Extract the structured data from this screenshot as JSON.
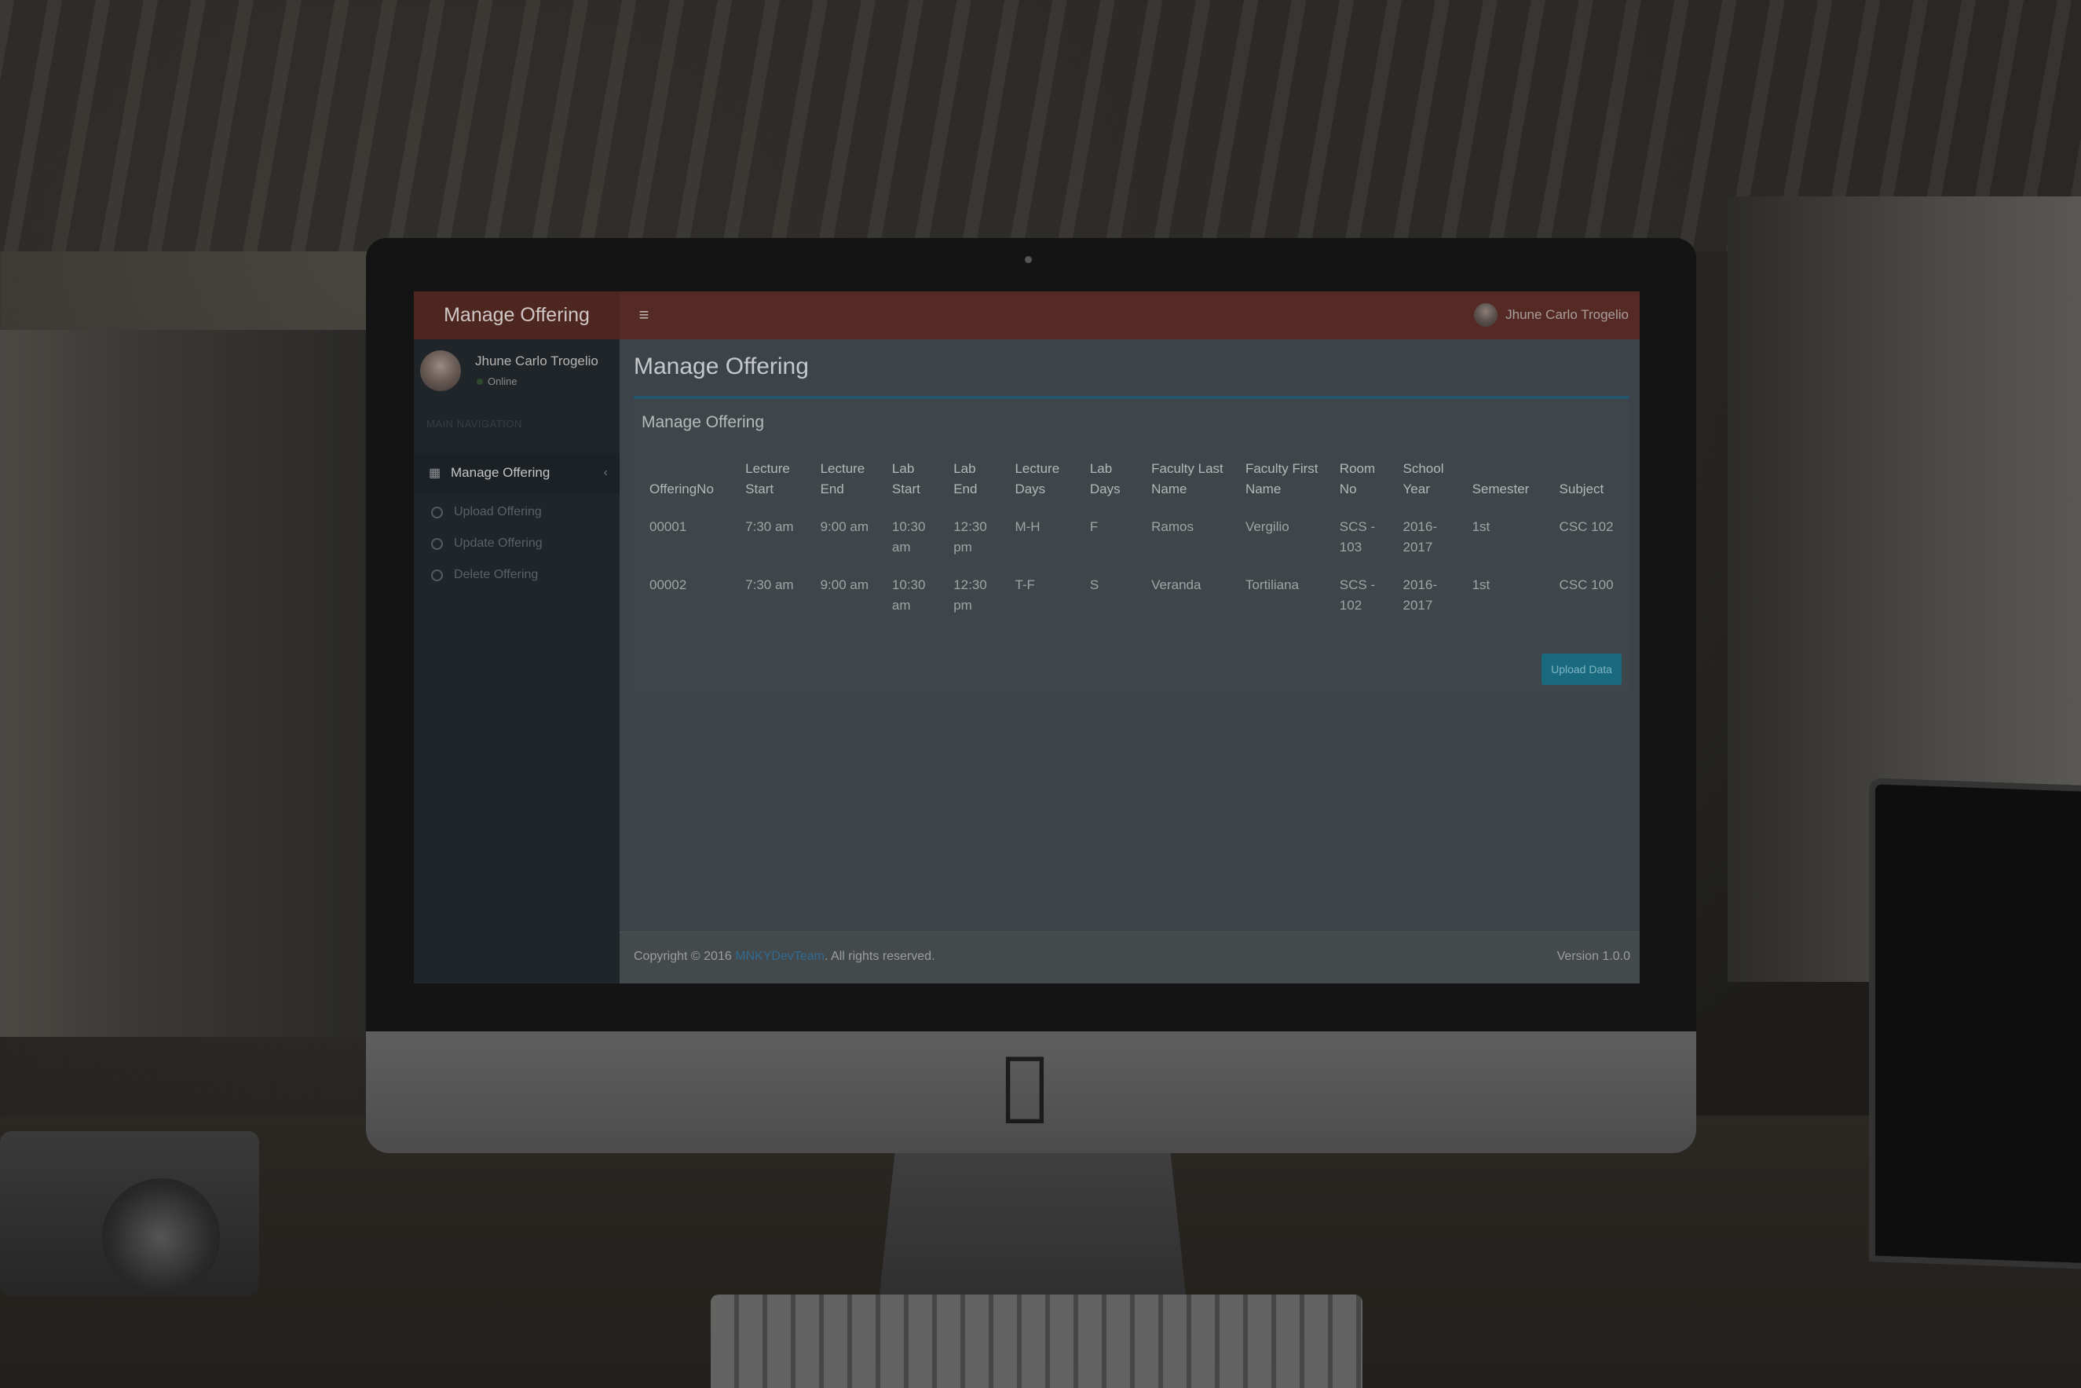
{
  "app": {
    "brand": "Manage Offering",
    "menu_icon": "hamburger-icon",
    "user_name": "Jhune Carlo Trogelio"
  },
  "sidebar": {
    "user_name": "Jhune Carlo Trogelio",
    "status": "Online",
    "nav_header": "MAIN NAVIGATION",
    "main_item": {
      "label": "Manage Offering",
      "icon": "table-icon",
      "chevron": "chevron-left-icon"
    },
    "sub_items": [
      {
        "label": "Upload Offering"
      },
      {
        "label": "Update Offering"
      },
      {
        "label": "Delete Offering"
      }
    ]
  },
  "main": {
    "page_title": "Manage Offering",
    "box_title": "Manage Offering",
    "table": {
      "headers": [
        "OfferingNo",
        "Lecture Start",
        "Lecture End",
        "Lab Start",
        "Lab End",
        "Lecture Days",
        "Lab Days",
        "Faculty Last Name",
        "Faculty First Name",
        "Room No",
        "School Year",
        "Semester",
        "Subject"
      ],
      "rows": [
        [
          "00001",
          "7:30 am",
          "9:00 am",
          "10:30 am",
          "12:30 pm",
          "M-H",
          "F",
          "Ramos",
          "Vergilio",
          "SCS - 103",
          "2016-2017",
          "1st",
          "CSC 102"
        ],
        [
          "00002",
          "7:30 am",
          "9:00 am",
          "10:30 am",
          "12:30 pm",
          "T-F",
          "S",
          "Veranda",
          "Tortiliana",
          "SCS - 102",
          "2016-2017",
          "1st",
          "CSC 100"
        ]
      ]
    },
    "upload_button": "Upload Data"
  },
  "footer": {
    "copyright_prefix": "Copyright © 2016",
    "team_link": "MNKYDevTeam",
    "copyright_suffix": ". All rights reserved.",
    "version": "Version 1.0.0"
  },
  "colors": {
    "header_bar": "#562a24",
    "sidebar_bg": "#1f2528",
    "content_bg": "#3d4449",
    "accent_rule": "#23546b",
    "button_bg": "#1a6a7f"
  }
}
